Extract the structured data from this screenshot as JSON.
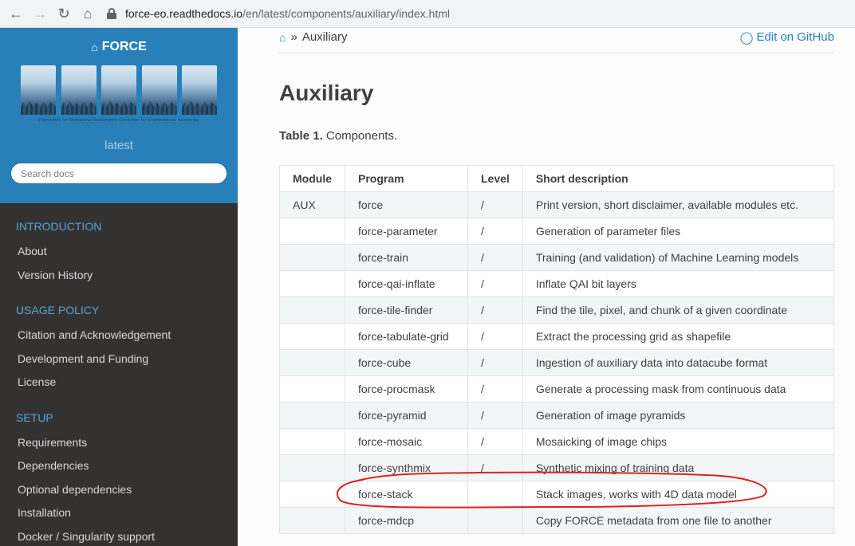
{
  "browser": {
    "back_icon": "←",
    "forward_icon": "→",
    "reload_icon": "↻",
    "home_icon": "⌂",
    "url_host": "force-eo.readthedocs.io",
    "url_path": "/en/latest/components/auxiliary/index.html"
  },
  "sidebar": {
    "brand": "FORCE",
    "logo_text": "FORCE",
    "logo_letters": [
      "F",
      "O",
      "R",
      "C",
      "E"
    ],
    "logo_tagline": "Framework for Operational Radiometric Correction for Environmental monitoring",
    "version": "latest",
    "search_placeholder": "Search docs",
    "sections": [
      {
        "title": "INTRODUCTION",
        "items": [
          "About",
          "Version History"
        ]
      },
      {
        "title": "USAGE POLICY",
        "items": [
          "Citation and Acknowledgement",
          "Development and Funding",
          "License"
        ]
      },
      {
        "title": "SETUP",
        "items": [
          "Requirements",
          "Dependencies",
          "Optional dependencies",
          "Installation",
          "Docker / Singularity support"
        ]
      }
    ],
    "colors": {
      "header_bg": "#2980b9",
      "nav_bg": "#343131",
      "section_color": "#55a5d9"
    }
  },
  "breadcrumb": {
    "current": "Auxiliary",
    "edit_label": "Edit on GitHub"
  },
  "page": {
    "title": "Auxiliary",
    "caption_label": "Table 1.",
    "caption_text": " Components."
  },
  "table": {
    "headers": [
      "Module",
      "Program",
      "Level",
      "Short description"
    ],
    "rows": [
      [
        "AUX",
        "force",
        "/",
        "Print version, short disclaimer, available modules etc."
      ],
      [
        "",
        "force-parameter",
        "/",
        "Generation of parameter files"
      ],
      [
        "",
        "force-train",
        "/",
        "Training (and validation) of Machine Learning models"
      ],
      [
        "",
        "force-qai-inflate",
        "/",
        "Inflate QAI bit layers"
      ],
      [
        "",
        "force-tile-finder",
        "/",
        "Find the tile, pixel, and chunk of a given coordinate"
      ],
      [
        "",
        "force-tabulate-grid",
        "/",
        "Extract the processing grid as shapefile"
      ],
      [
        "",
        "force-cube",
        "/",
        "Ingestion of auxiliary data into datacube format"
      ],
      [
        "",
        "force-procmask",
        "/",
        "Generate a processing mask from continuous data"
      ],
      [
        "",
        "force-pyramid",
        "/",
        "Generation of image pyramids"
      ],
      [
        "",
        "force-mosaic",
        "/",
        "Mosaicking of image chips"
      ],
      [
        "",
        "force-synthmix",
        "/",
        "Synthetic mixing of training data"
      ],
      [
        "",
        "force-stack",
        "",
        "Stack images, works with 4D data model"
      ],
      [
        "",
        "force-mdcp",
        "",
        "Copy FORCE metadata from one file to another"
      ]
    ]
  },
  "annotation": {
    "color": "#e02020",
    "target_row": "force-stack"
  }
}
